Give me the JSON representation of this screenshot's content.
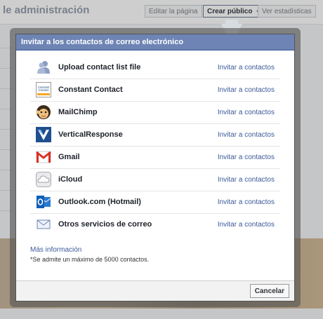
{
  "background": {
    "page_title": "le administración",
    "buttons": [
      {
        "label": "Editar la página"
      },
      {
        "label": "Crear público"
      },
      {
        "label": "Ver estadísticas"
      }
    ]
  },
  "dialog": {
    "title": "Invitar a los contactos de correo electrónico",
    "header_color": "#6d84b4",
    "rows": [
      {
        "label": "Upload contact list file",
        "action": "Invitar a contactos",
        "icon": "contacts-upload-icon"
      },
      {
        "label": "Constant Contact",
        "action": "Invitar a contactos",
        "icon": "constant-contact-icon"
      },
      {
        "label": "MailChimp",
        "action": "Invitar a contactos",
        "icon": "mailchimp-icon"
      },
      {
        "label": "VerticalResponse",
        "action": "Invitar a contactos",
        "icon": "verticalresponse-icon"
      },
      {
        "label": "Gmail",
        "action": "Invitar a contactos",
        "icon": "gmail-icon"
      },
      {
        "label": "iCloud",
        "action": "Invitar a contactos",
        "icon": "icloud-icon"
      },
      {
        "label": "Outlook.com (Hotmail)",
        "action": "Invitar a contactos",
        "icon": "outlook-icon"
      },
      {
        "label": "Otros servicios de correo",
        "action": "Invitar a contactos",
        "icon": "envelope-icon"
      }
    ],
    "info_link": "Más información",
    "info_note": "*Se admite un máximo de 5000 contactos.",
    "cancel_label": "Cancelar"
  }
}
